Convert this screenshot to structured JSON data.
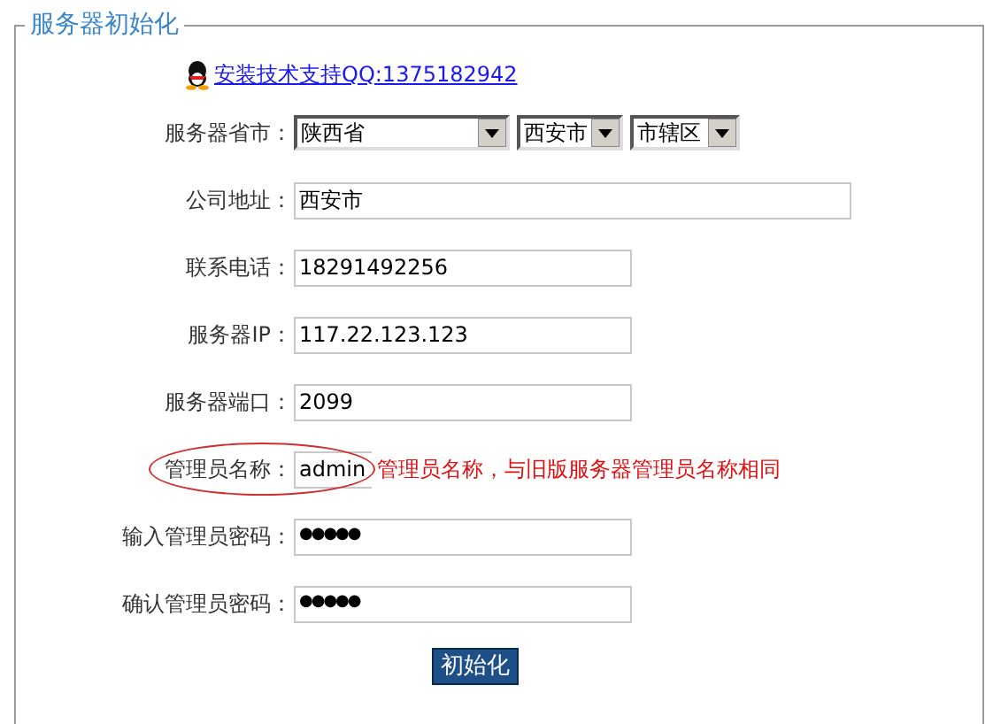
{
  "panel": {
    "title": "服务器初始化"
  },
  "support_link": "安装技术支持QQ:1375182942",
  "fields": [
    {
      "kind": "selects",
      "label": "服务器省市：",
      "values": [
        "陕西省",
        "西安市",
        "市辖区"
      ]
    },
    {
      "kind": "text",
      "label": "公司地址：",
      "value": "西安市",
      "wide": true
    },
    {
      "kind": "text",
      "label": "联系电话：",
      "value": "18291492256"
    },
    {
      "kind": "text",
      "label": "服务器IP：",
      "value": "117.22.123.123"
    },
    {
      "kind": "text",
      "label": "服务器端口：",
      "value": "2099"
    },
    {
      "kind": "text",
      "label": "管理员名称：",
      "value": "admin",
      "highlighted": true,
      "note": "管理员名称，与旧版服务器管理员名称相同"
    },
    {
      "kind": "password",
      "label": "输入管理员密码：",
      "value": "●●●●●"
    },
    {
      "kind": "password",
      "label": "确认管理员密码：",
      "value": "●●●●●"
    }
  ],
  "submit": "初始化"
}
